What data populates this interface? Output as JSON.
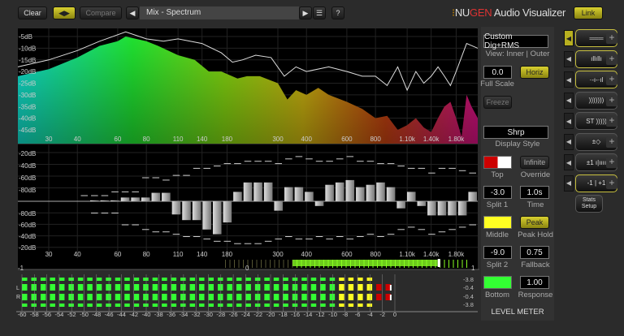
{
  "toolbar": {
    "clear": "Clear",
    "swap_icon": "swap-arrows-icon",
    "compare": "Compare",
    "preset": "Mix - Spectrum",
    "help": "?",
    "brand_nu": "NU",
    "brand_gen": "GEN",
    "brand_rest": " Audio Visualizer",
    "link": "Link"
  },
  "colors": {
    "accent": "#c8c020",
    "top": "#cc0000",
    "middle": "#ffff22",
    "bottom": "#33ff33"
  },
  "spectrum": {
    "y_labels": [
      "-5dB",
      "-10dB",
      "-15dB",
      "-20dB",
      "-25dB",
      "-30dB",
      "-35dB",
      "-40dB",
      "-45dB"
    ],
    "freq_labels": [
      "30",
      "40",
      "60",
      "80",
      "110",
      "140",
      "180",
      "300",
      "400",
      "600",
      "800",
      "1.10k",
      "1.40k",
      "1.80k"
    ],
    "freq_values": [
      30,
      40,
      60,
      80,
      110,
      140,
      180,
      300,
      400,
      600,
      800,
      1100,
      1400,
      1800
    ],
    "fill": [
      [
        22,
        -22
      ],
      [
        30,
        -19
      ],
      [
        40,
        -14
      ],
      [
        50,
        -9
      ],
      [
        60,
        -7
      ],
      [
        65,
        -5
      ],
      [
        80,
        -7
      ],
      [
        90,
        -9
      ],
      [
        110,
        -13
      ],
      [
        130,
        -15
      ],
      [
        150,
        -20
      ],
      [
        170,
        -20
      ],
      [
        200,
        -23
      ],
      [
        220,
        -22
      ],
      [
        250,
        -22
      ],
      [
        300,
        -25
      ],
      [
        330,
        -32
      ],
      [
        360,
        -28
      ],
      [
        400,
        -30
      ],
      [
        450,
        -27
      ],
      [
        500,
        -30
      ],
      [
        600,
        -33
      ],
      [
        700,
        -36
      ],
      [
        800,
        -40
      ],
      [
        900,
        -39
      ],
      [
        1000,
        -45
      ],
      [
        1100,
        -43
      ],
      [
        1200,
        -40
      ],
      [
        1300,
        -44
      ],
      [
        1400,
        -46
      ],
      [
        1500,
        -40
      ],
      [
        1600,
        -35
      ],
      [
        1700,
        -33
      ],
      [
        1800,
        -40
      ],
      [
        1900,
        -48
      ],
      [
        2000,
        -30
      ],
      [
        2100,
        -35
      ],
      [
        2236,
        -40
      ]
    ],
    "peak": [
      [
        22,
        -18
      ],
      [
        30,
        -15
      ],
      [
        40,
        -11
      ],
      [
        50,
        -7
      ],
      [
        65,
        -3
      ],
      [
        80,
        -6
      ],
      [
        95,
        -7
      ],
      [
        110,
        -6
      ],
      [
        140,
        -8
      ],
      [
        170,
        -12
      ],
      [
        190,
        -16
      ],
      [
        210,
        -15
      ],
      [
        240,
        -13
      ],
      [
        280,
        -14
      ],
      [
        320,
        -22
      ],
      [
        360,
        -18
      ],
      [
        400,
        -20
      ],
      [
        500,
        -18
      ],
      [
        600,
        -20
      ],
      [
        700,
        -22
      ],
      [
        800,
        -22
      ],
      [
        900,
        -26
      ],
      [
        1000,
        -18
      ],
      [
        1100,
        -28
      ],
      [
        1200,
        -20
      ],
      [
        1300,
        -25
      ],
      [
        1400,
        -22
      ],
      [
        1500,
        -18
      ],
      [
        1600,
        -22
      ],
      [
        1700,
        -26
      ],
      [
        1800,
        -20
      ],
      [
        2000,
        -8
      ],
      [
        2236,
        -10
      ]
    ]
  },
  "bands": {
    "y_labels": [
      "-20dB",
      "-40dB",
      "-60dB",
      "-80dB",
      "-80dB",
      "-60dB",
      "-40dB",
      "-20dB"
    ],
    "values": [
      0,
      0,
      0,
      0,
      0,
      0,
      0,
      0.02,
      0.02,
      0.02,
      0.08,
      0.08,
      0.08,
      0.18,
      0.18,
      -0.28,
      -0.4,
      -0.4,
      -0.6,
      -0.7,
      -0.45,
      0.2,
      0.4,
      0.4,
      0.4,
      -0.2,
      0.3,
      0.3,
      0.2,
      -0.1,
      0.35,
      0.4,
      0.45,
      0.3,
      0.35,
      0.4,
      0.3,
      -0.15,
      0.2,
      -0.1,
      -0.3,
      -0.3,
      -0.3,
      -0.3,
      0.2
    ],
    "hi": [
      0,
      0,
      0,
      0,
      0,
      0,
      0.12,
      0.12,
      0.12,
      0.2,
      0.2,
      0.2,
      0.5,
      0.5,
      0.45,
      0.55,
      0.55,
      0.7,
      0.7,
      0.75,
      0.8,
      0.8,
      0.85,
      0.85,
      0.85,
      0.8,
      0.9,
      0.95,
      0.9,
      0.85,
      0.85,
      0.9,
      0.95,
      0.85,
      0.85,
      0.8,
      0.8,
      0.75,
      0.7,
      0.7,
      0.6,
      0.7,
      0.7,
      0.65,
      0.6
    ],
    "lo": [
      0,
      0,
      0,
      0,
      0,
      0,
      0,
      -0.25,
      -0.25,
      -0.25,
      -0.5,
      -0.5,
      -0.6,
      -0.65,
      -0.65,
      -0.7,
      -0.75,
      -0.75,
      -0.8,
      -0.85,
      -0.85,
      -0.9,
      -0.9,
      -0.9,
      -0.85,
      -0.8,
      -0.75,
      -0.8,
      -0.8,
      -0.75,
      -0.8,
      -0.75,
      -0.8,
      -0.75,
      -0.7,
      -0.75,
      -0.7,
      -0.6,
      -0.55,
      -0.6,
      -0.7,
      -0.65,
      -0.6,
      -0.55,
      -0.5
    ]
  },
  "correlation": {
    "left": "-1",
    "mid": "0",
    "right": "1",
    "value": 0.85
  },
  "meter": {
    "channels": [
      "L",
      "R"
    ],
    "peak_readouts": [
      "-3.8",
      "-0.4",
      "-0.4",
      "-3.8"
    ],
    "peak_db": [
      -3.8,
      -0.4,
      -0.4,
      -3.8
    ],
    "scale": [
      "-60",
      "-58",
      "-56",
      "-54",
      "-52",
      "-50",
      "-48",
      "-46",
      "-44",
      "-42",
      "-40",
      "-38",
      "-36",
      "-34",
      "-32",
      "-30",
      "-28",
      "-26",
      "-24",
      "-22",
      "-20",
      "-18",
      "-16",
      "-14",
      "-12",
      "-10",
      "-8",
      "-6",
      "-4",
      "-2",
      "0"
    ]
  },
  "settings": {
    "mode": "Custom Dig+RMS",
    "view": "View: Inner | Outer",
    "full_scale": "0.0",
    "full_scale_label": "Full Scale",
    "horiz": "Horiz",
    "freeze": "Freeze",
    "display_style": "Shrp",
    "display_style_label": "Display Style",
    "top_label": "Top",
    "infinite": "Infinite",
    "override_label": "Override",
    "split1": "-3.0",
    "split1_label": "Split 1",
    "time": "1.0s",
    "time_label": "Time",
    "middle_label": "Middle",
    "peak": "Peak",
    "peak_hold_label": "Peak Hold",
    "split2": "-9.0",
    "split2_label": "Split 2",
    "fallback": "0.75",
    "fallback_label": "Fallback",
    "bottom_label": "Bottom",
    "response": "1.00",
    "response_label": "Response",
    "section": "LEVEL METER"
  },
  "modules": [
    {
      "name": "level-meter-module",
      "glyph": "═══"
    },
    {
      "name": "spectrum-module",
      "glyph": "ıllıllı"
    },
    {
      "name": "band-module",
      "glyph": "·-ı-·ıl"
    },
    {
      "name": "waveform-module",
      "glyph": ")))))))"
    },
    {
      "name": "stereo-module",
      "glyph": "ST )))))"
    },
    {
      "name": "vectorscope-module",
      "glyph": "±◇"
    },
    {
      "name": "correlation-bars-module",
      "glyph": "±1 ı|ıııı"
    },
    {
      "name": "correlation-module",
      "glyph": "-1 | +1"
    }
  ],
  "stats": {
    "line1": "Stats",
    "line2": "Setup"
  }
}
